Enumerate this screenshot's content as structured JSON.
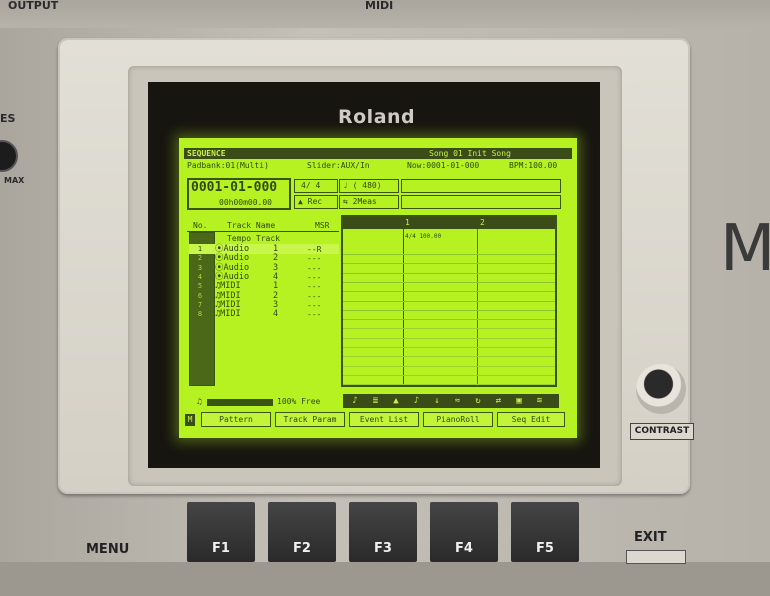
{
  "device": {
    "output_label": "OUTPUT",
    "midi_label": "MIDI",
    "volume_label_fragment": "ES",
    "max_label": "MAX",
    "brand": "Roland",
    "brand_partial": "M",
    "contrast_label": "CONTRAST",
    "menu_label": "MENU",
    "exit_label": "EXIT",
    "function_keys": [
      "F1",
      "F2",
      "F3",
      "F4",
      "F5"
    ]
  },
  "lcd": {
    "mode": "SEQUENCE",
    "song": "Song 01 Init Song",
    "status": {
      "padbank": "Padbank:01(Multi)",
      "slider": "Slider:AUX/In",
      "now": "Now:0001-01-000",
      "bpm": "BPM:100.00"
    },
    "position": "0001-01-000",
    "time": "00h00m00.00",
    "time_signature": "4/ 4",
    "resolution": "♩ ( 480)",
    "rec_label": "Rec",
    "loop_label": "2Meas",
    "columns": {
      "no": "No.",
      "track_name": "Track Name",
      "msr": "MSR"
    },
    "grid_markers": [
      "1",
      "2"
    ],
    "tempo_track": "Tempo Track",
    "tempo_event": "4/4 100.00",
    "tracks": [
      {
        "no": "1",
        "icon": "⦿",
        "name": "Audio",
        "num": "1",
        "msr": "--R"
      },
      {
        "no": "2",
        "icon": "⦿",
        "name": "Audio",
        "num": "2",
        "msr": "---"
      },
      {
        "no": "3",
        "icon": "⦿",
        "name": "Audio",
        "num": "3",
        "msr": "---"
      },
      {
        "no": "4",
        "icon": "⦿",
        "name": "Audio",
        "num": "4",
        "msr": "---"
      },
      {
        "no": "5",
        "icon": "♫",
        "name": "MIDI",
        "num": "1",
        "msr": "---"
      },
      {
        "no": "6",
        "icon": "♫",
        "name": "MIDI",
        "num": "2",
        "msr": "---"
      },
      {
        "no": "7",
        "icon": "♫",
        "name": "MIDI",
        "num": "3",
        "msr": "---"
      },
      {
        "no": "8",
        "icon": "♫",
        "name": "MIDI",
        "num": "4",
        "msr": "---"
      }
    ],
    "free_text": "100% Free",
    "free_fraction": 1.0,
    "tool_icons": [
      "♪",
      "≣",
      "▲",
      "♪",
      "↓",
      "≈",
      "↻",
      "⇄",
      "▣",
      "≋"
    ],
    "func_buttons": [
      "Pattern",
      "Track Param",
      "Event List",
      "PianoRoll",
      "Seq Edit"
    ],
    "left_marker": "M"
  }
}
